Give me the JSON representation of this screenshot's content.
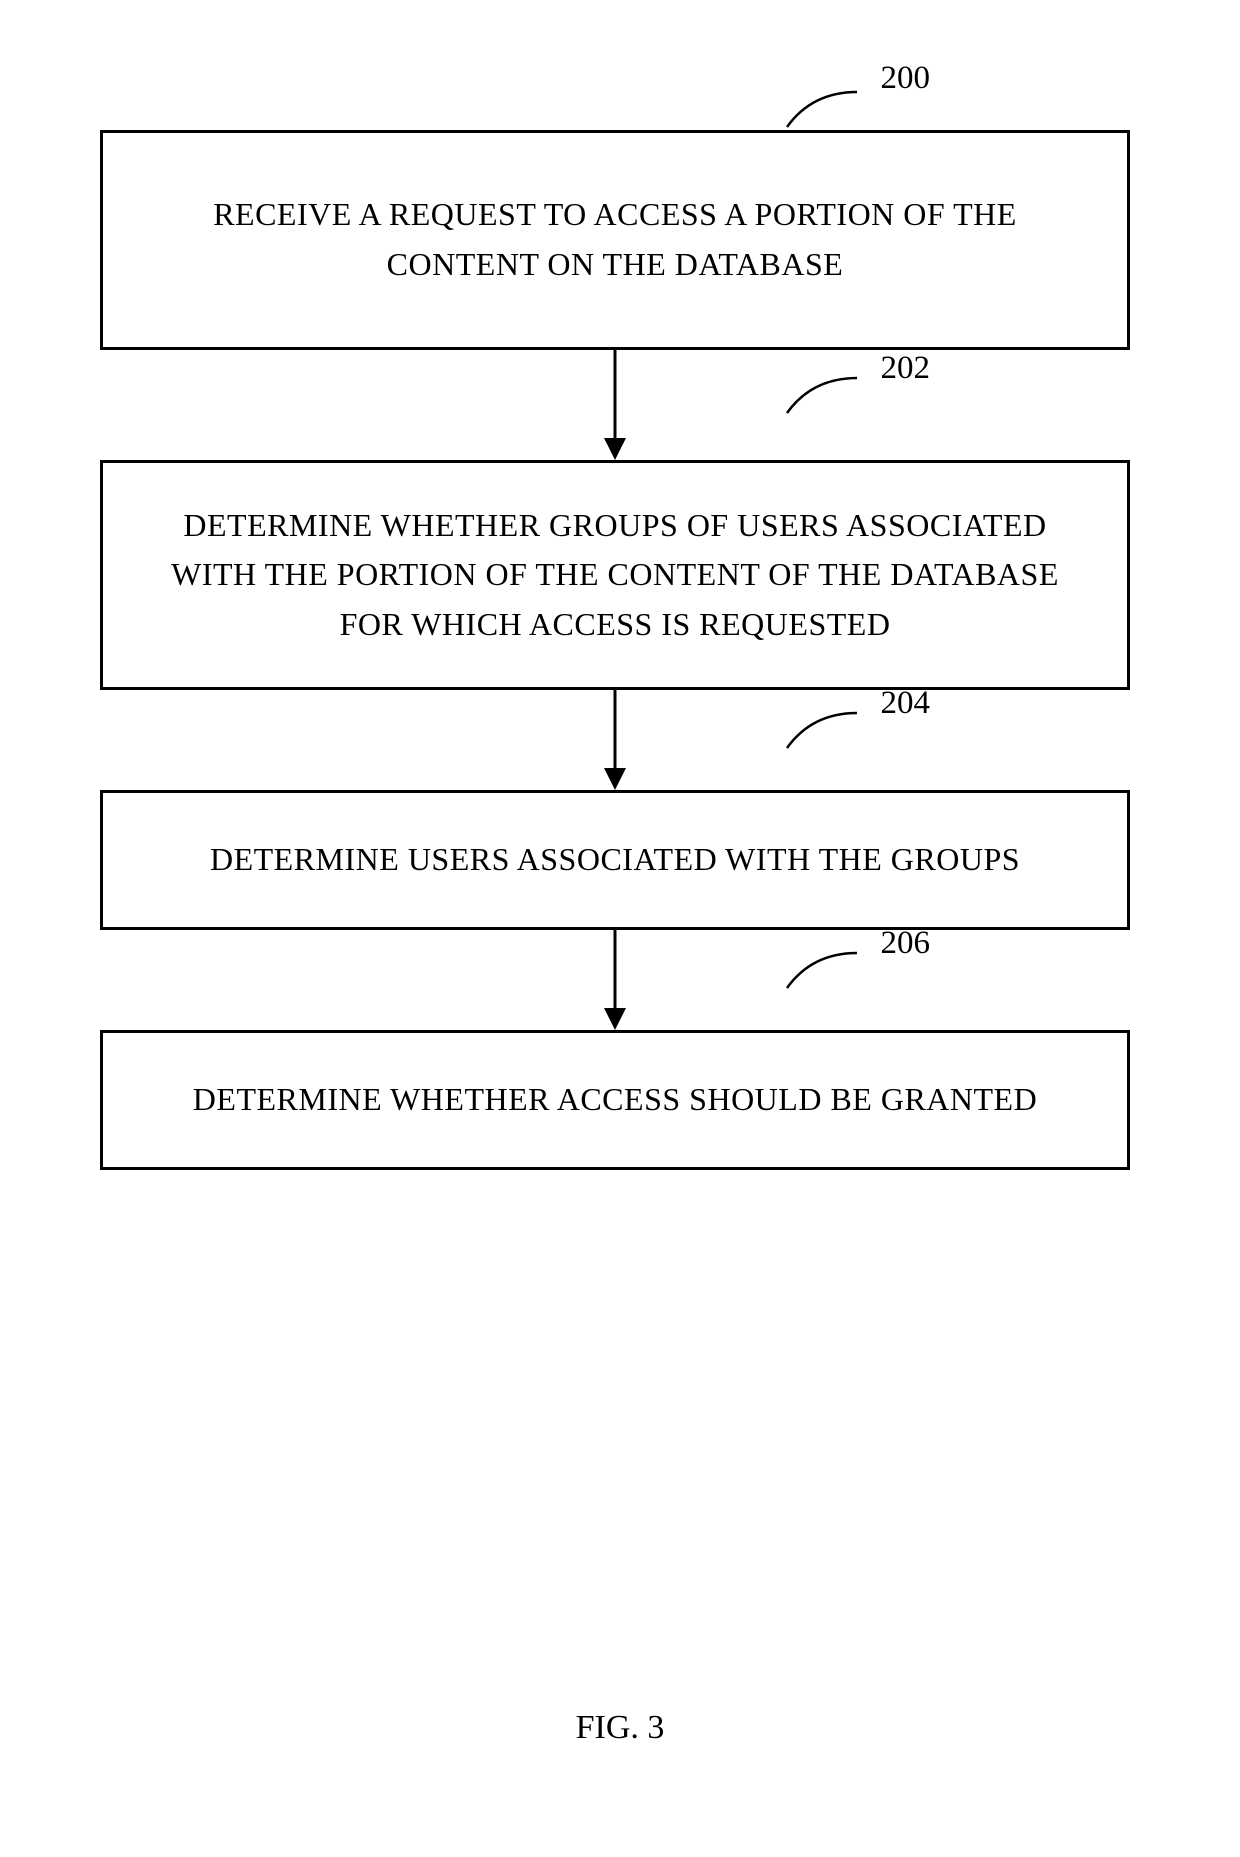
{
  "flowchart": {
    "steps": [
      {
        "label": "200",
        "text": "RECEIVE A REQUEST TO  ACCESS A PORTION OF THE CONTENT ON THE DATABASE"
      },
      {
        "label": "202",
        "text": "DETERMINE WHETHER GROUPS OF USERS ASSOCIATED WITH THE PORTION OF THE CONTENT OF THE DATABASE FOR WHICH ACCESS IS REQUESTED"
      },
      {
        "label": "204",
        "text": "DETERMINE USERS ASSOCIATED WITH THE GROUPS"
      },
      {
        "label": "206",
        "text": "DETERMINE WHETHER ACCESS SHOULD BE GRANTED"
      }
    ]
  },
  "caption": "FIG. 3"
}
